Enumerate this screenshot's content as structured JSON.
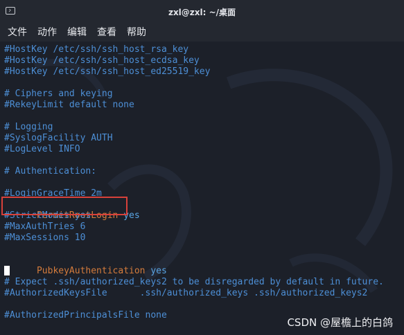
{
  "window": {
    "title": "zxl@zxl: ~/桌面"
  },
  "menu": {
    "items": [
      "文件",
      "动作",
      "编辑",
      "查看",
      "帮助"
    ]
  },
  "terminal": {
    "lines": [
      {
        "key": "#HostKey /etc/ssh/ssh_host_rsa_key",
        "type": "comment"
      },
      {
        "key": "#HostKey /etc/ssh/ssh_host_ecdsa_key",
        "type": "comment"
      },
      {
        "key": "#HostKey /etc/ssh/ssh_host_ed25519_key",
        "type": "comment"
      },
      {
        "key": "",
        "type": "blank"
      },
      {
        "key": "# Ciphers and keying",
        "type": "comment"
      },
      {
        "key": "#RekeyLimit default none",
        "type": "comment"
      },
      {
        "key": "",
        "type": "blank"
      },
      {
        "key": "# Logging",
        "type": "comment"
      },
      {
        "key": "#SyslogFacility AUTH",
        "type": "comment"
      },
      {
        "key": "#LogLevel INFO",
        "type": "comment"
      },
      {
        "key": "",
        "type": "blank"
      },
      {
        "key": "# Authentication:",
        "type": "comment"
      },
      {
        "key": "",
        "type": "blank"
      },
      {
        "key": "#LoginGraceTime 2m",
        "type": "comment"
      },
      {
        "key": "PermitRootLogin",
        "value": "yes",
        "type": "directive"
      },
      {
        "key": "#StrictModes yes",
        "type": "comment"
      },
      {
        "key": "#MaxAuthTries 6",
        "type": "comment"
      },
      {
        "key": "#MaxSessions 10",
        "type": "comment"
      },
      {
        "key": "",
        "type": "blank"
      },
      {
        "key": "PubkeyAuthentication",
        "value": "yes",
        "type": "directive"
      },
      {
        "key": "",
        "type": "cursor"
      },
      {
        "key": "# Expect .ssh/authorized_keys2 to be disregarded by default in future.",
        "type": "comment"
      },
      {
        "key": "#AuthorizedKeysFile      .ssh/authorized_keys .ssh/authorized_keys2",
        "type": "comment"
      },
      {
        "key": "",
        "type": "blank"
      },
      {
        "key": "#AuthorizedPrincipalsFile none",
        "type": "comment"
      }
    ]
  },
  "watermark": {
    "text": "CSDN @屋檐上的白鸽"
  },
  "colors": {
    "comment": "#4d8fd6",
    "directive_key": "#d57c3c",
    "directive_value": "#5aa5e4",
    "highlight_border": "#d8413a"
  }
}
